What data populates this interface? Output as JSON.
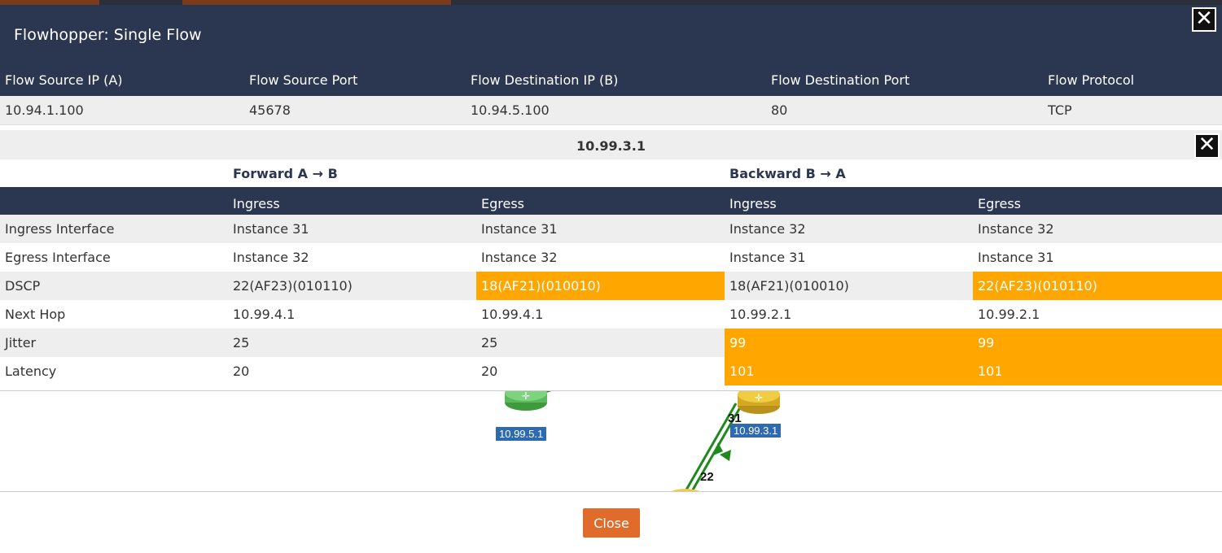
{
  "dialog": {
    "title": "Flowhopper:  Single Flow",
    "close_label": "Close"
  },
  "flow": {
    "headers": [
      "Flow Source IP (A)",
      "Flow Source Port",
      "Flow Destination IP (B)",
      "Flow Destination Port",
      "Flow Protocol"
    ],
    "values": [
      "10.94.1.100",
      "45678",
      "10.94.5.100",
      "80",
      "TCP"
    ]
  },
  "hop": {
    "title": "10.99.3.1",
    "forward_label": "Forward A → B",
    "backward_label": "Backward B → A",
    "columns": [
      "Ingress",
      "Egress",
      "Ingress",
      "Egress"
    ],
    "rows": [
      {
        "label": "Ingress Interface",
        "values": [
          "Instance 31",
          "Instance 31",
          "Instance 32",
          "Instance 32"
        ],
        "highlight": [
          false,
          false,
          false,
          false
        ]
      },
      {
        "label": "Egress Interface",
        "values": [
          "Instance 32",
          "Instance 32",
          "Instance 31",
          "Instance 31"
        ],
        "highlight": [
          false,
          false,
          false,
          false
        ]
      },
      {
        "label": "DSCP",
        "values": [
          "22(AF23)(010110)",
          "18(AF21)(010010)",
          "18(AF21)(010010)",
          "22(AF23)(010110)"
        ],
        "highlight": [
          false,
          true,
          false,
          true
        ]
      },
      {
        "label": "Next Hop",
        "values": [
          "10.99.4.1",
          "10.99.4.1",
          "10.99.2.1",
          "10.99.2.1"
        ],
        "highlight": [
          false,
          false,
          false,
          false
        ]
      },
      {
        "label": "Jitter",
        "values": [
          "25",
          "25",
          "99",
          "99"
        ],
        "highlight": [
          false,
          false,
          true,
          true
        ]
      },
      {
        "label": "Latency",
        "values": [
          "20",
          "20",
          "101",
          "101"
        ],
        "highlight": [
          false,
          false,
          true,
          true
        ]
      }
    ]
  },
  "topology": {
    "nodes": [
      {
        "label": "10.99.5.1",
        "color": "#5cb85c"
      },
      {
        "label": "10.99.3.1",
        "color": "#e6c02a"
      }
    ],
    "links": [
      "31",
      "22"
    ]
  },
  "colors": {
    "header_bg": "#2b3651",
    "highlight": "#ffa600",
    "close_button": "#e06b2a",
    "link_green": "#1e8a1e"
  }
}
